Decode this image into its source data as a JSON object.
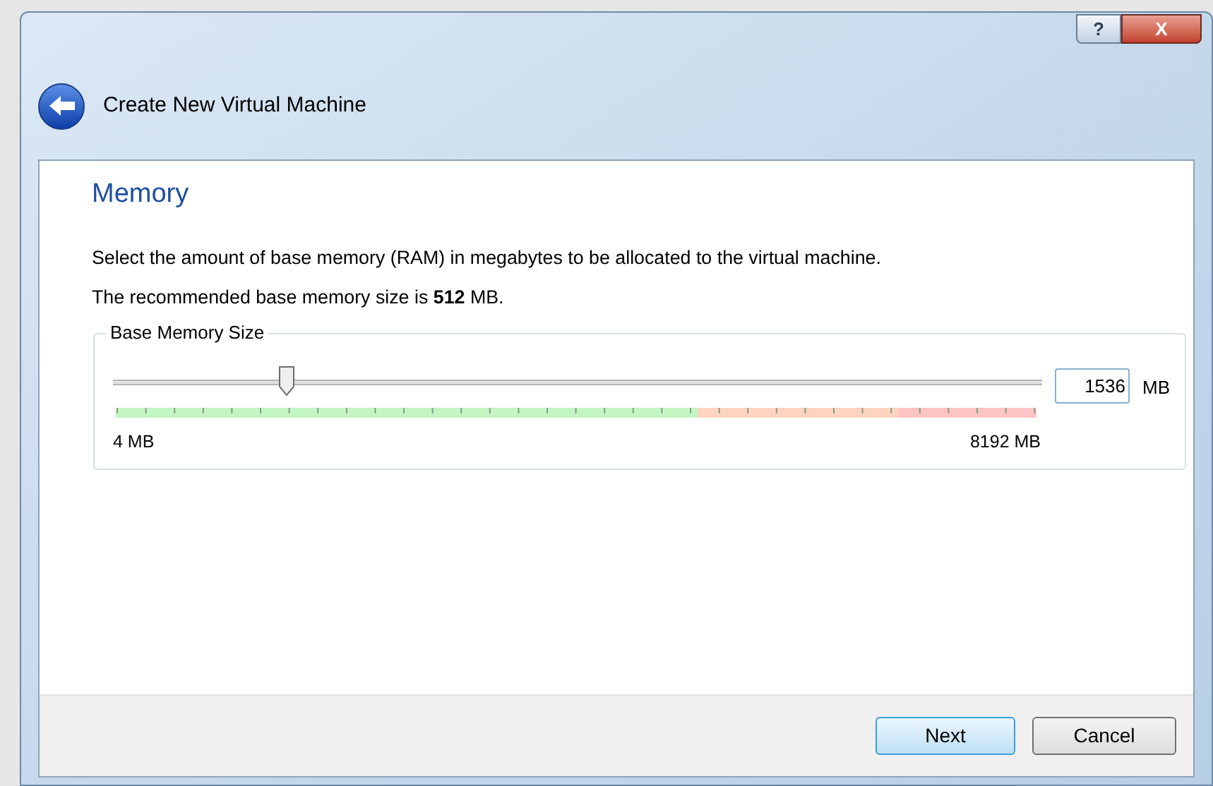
{
  "window": {
    "title": "Create New Virtual Machine",
    "caption_buttons": [
      {
        "kind": "help",
        "label": "?"
      },
      {
        "kind": "close",
        "label": "X"
      }
    ]
  },
  "page": {
    "heading": "Memory",
    "description": "Select the amount of base memory (RAM) in megabytes to be allocated to the virtual machine.",
    "recommendation": "The recommended base memory size is **512** MB."
  },
  "memory_group": {
    "label": "Base Memory Size",
    "slider": {
      "level": 0.187,
      "min_label": "4 MB",
      "max_label": "8192 MB"
    },
    "field": {
      "value": "1536",
      "unit": "MB"
    }
  },
  "buttons": [
    {
      "label": "Next",
      "default": true
    },
    {
      "label": "Cancel",
      "default": false
    }
  ]
}
